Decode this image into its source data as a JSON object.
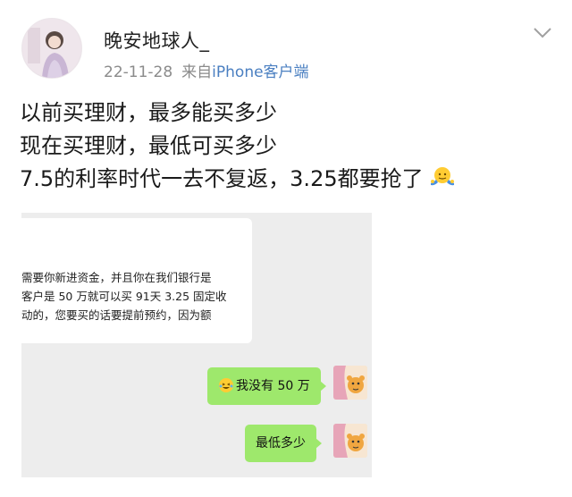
{
  "author": {
    "name": "晚安地球人_",
    "date": "22-11-28",
    "source_prefix": "来自",
    "source_client": "iPhone客户端",
    "avatar_icon": "user-avatar-photo"
  },
  "post_text": [
    "以前买理财，最多能买多少",
    "现在买理财，最低可买多少",
    "7.5的利率时代一去不复返，3.25都要抢了"
  ],
  "inline_emoji": "shrug-emoji",
  "chat": {
    "incoming_lines": [
      "需要你新进资金，并且你在我们银行是",
      "客户是 50 万就可以买 91天 3.25 固定收",
      "动的，您要买的话要提前预约，因为额"
    ],
    "outgoing": [
      {
        "text": "我没有 50 万",
        "emoji": "laughing-tears-emoji"
      },
      {
        "text": "最低多少"
      }
    ]
  },
  "colors": {
    "link": "#4a7fc1",
    "bubble_green": "#9ee86c",
    "chat_bg": "#ededed"
  }
}
